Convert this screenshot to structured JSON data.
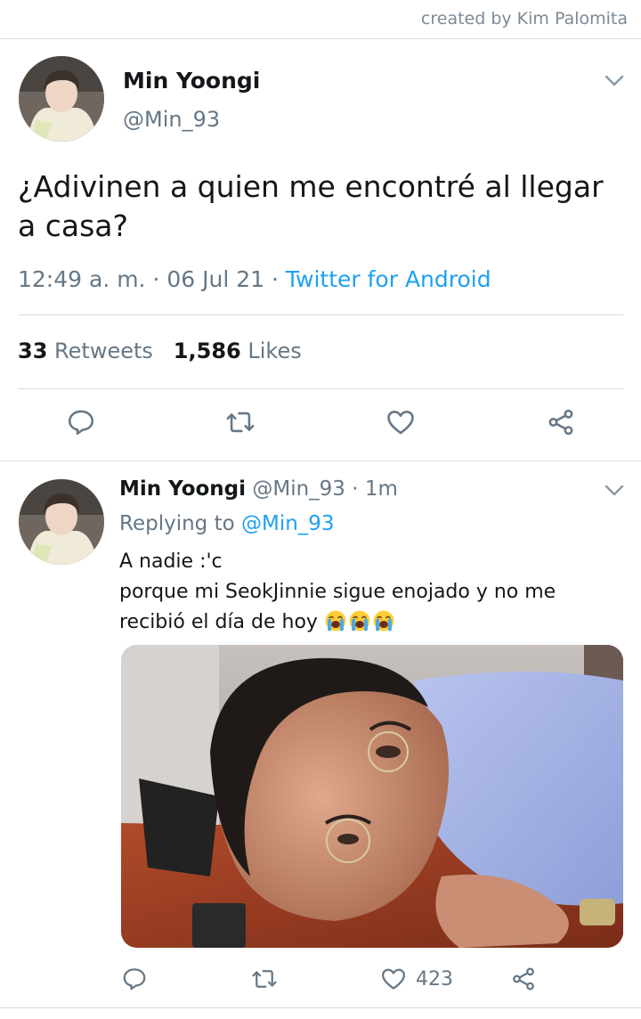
{
  "credit": "created by Kim Palomita",
  "main_tweet": {
    "name": "Min Yoongi",
    "handle": "@Min_93",
    "text": "¿Adivinen a quien me encontré al llegar a casa?",
    "time": "12:49 a. m.",
    "sep": " · ",
    "date": "06 Jul 21",
    "source": "Twitter for Android",
    "retweets_count": "33",
    "retweets_label": "Retweets",
    "likes_count": "1,586",
    "likes_label": "Likes"
  },
  "reply_tweet": {
    "name": "Min Yoongi",
    "handle": "@Min_93",
    "age": "1m",
    "replying_label": "Replying to",
    "replying_to": "@Min_93",
    "line1": "A nadie :'c",
    "line2": "porque mi SeokJinnie sigue enojado y no me recibió el día de hoy",
    "emoji": "loudly-crying-face x3",
    "like_count": "423"
  },
  "icons": {
    "reply": "reply-bubble-icon",
    "retweet": "retweet-icon",
    "like": "heart-icon",
    "share": "share-icon",
    "menu": "chevron-down-icon"
  },
  "colors": {
    "accent": "#1da1f2",
    "text": "#14171a",
    "muted": "#657786",
    "divider": "#d6dce1"
  }
}
